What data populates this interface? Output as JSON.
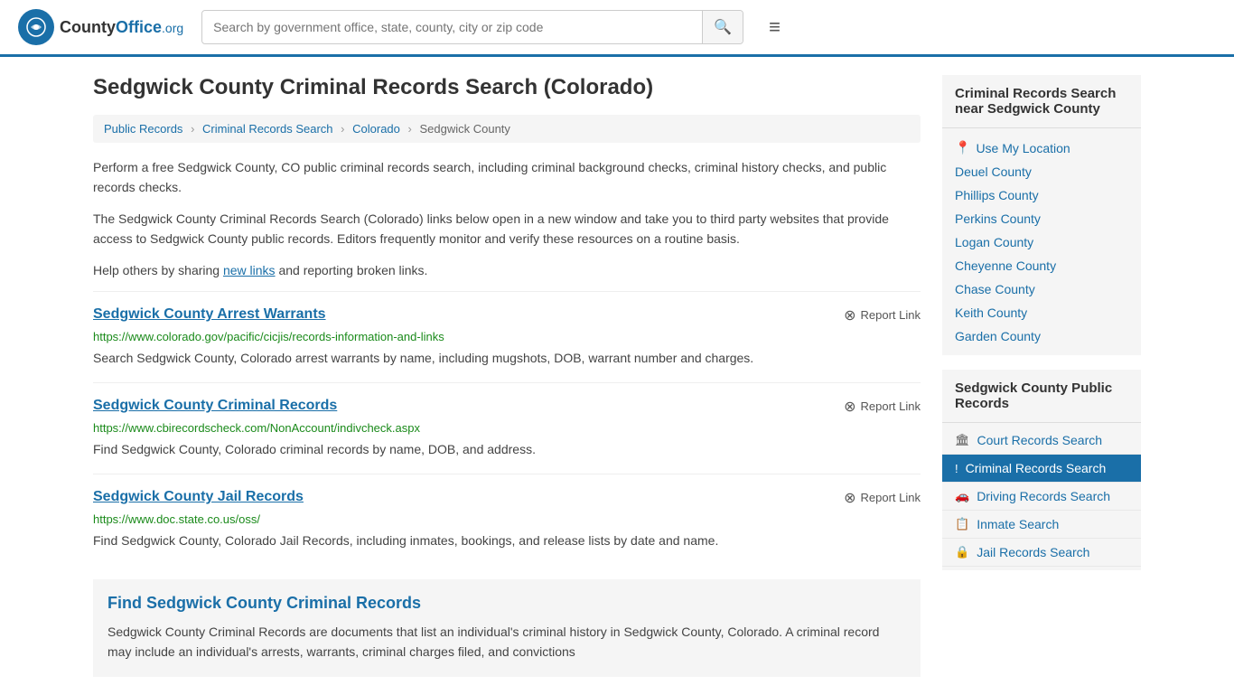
{
  "header": {
    "logo_text": "CountyOffice",
    "logo_suffix": ".org",
    "search_placeholder": "Search by government office, state, county, city or zip code",
    "search_icon": "🔍",
    "menu_icon": "≡"
  },
  "page": {
    "title": "Sedgwick County Criminal Records Search (Colorado)",
    "breadcrumb": [
      {
        "label": "Public Records",
        "href": "#"
      },
      {
        "label": "Criminal Records Search",
        "href": "#"
      },
      {
        "label": "Colorado",
        "href": "#"
      },
      {
        "label": "Sedgwick County",
        "href": "#"
      }
    ],
    "desc1": "Perform a free Sedgwick County, CO public criminal records search, including criminal background checks, criminal history checks, and public records checks.",
    "desc2": "The Sedgwick County Criminal Records Search (Colorado) links below open in a new window and take you to third party websites that provide access to Sedgwick County public records. Editors frequently monitor and verify these resources on a routine basis.",
    "desc3_prefix": "Help others by sharing ",
    "desc3_link": "new links",
    "desc3_suffix": " and reporting broken links.",
    "records": [
      {
        "title": "Sedgwick County Arrest Warrants",
        "url": "https://www.colorado.gov/pacific/cicjis/records-information-and-links",
        "desc": "Search Sedgwick County, Colorado arrest warrants by name, including mugshots, DOB, warrant number and charges.",
        "report_label": "Report Link"
      },
      {
        "title": "Sedgwick County Criminal Records",
        "url": "https://www.cbirecordscheck.com/NonAccount/indivcheck.aspx",
        "desc": "Find Sedgwick County, Colorado criminal records by name, DOB, and address.",
        "report_label": "Report Link"
      },
      {
        "title": "Sedgwick County Jail Records",
        "url": "https://www.doc.state.co.us/oss/",
        "desc": "Find Sedgwick County, Colorado Jail Records, including inmates, bookings, and release lists by date and name.",
        "report_label": "Report Link"
      }
    ],
    "find_section": {
      "title": "Find Sedgwick County Criminal Records",
      "desc": "Sedgwick County Criminal Records are documents that list an individual's criminal history in Sedgwick County, Colorado. A criminal record may include an individual's arrests, warrants, criminal charges filed, and convictions"
    }
  },
  "sidebar": {
    "nearby_title": "Criminal Records Search near Sedgwick County",
    "use_my_location": "Use My Location",
    "nearby_counties": [
      {
        "label": "Deuel County",
        "href": "#"
      },
      {
        "label": "Phillips County",
        "href": "#"
      },
      {
        "label": "Perkins County",
        "href": "#"
      },
      {
        "label": "Logan County",
        "href": "#"
      },
      {
        "label": "Cheyenne County",
        "href": "#"
      },
      {
        "label": "Chase County",
        "href": "#"
      },
      {
        "label": "Keith County",
        "href": "#"
      },
      {
        "label": "Garden County",
        "href": "#"
      }
    ],
    "public_title": "Sedgwick County Public Records",
    "public_links": [
      {
        "label": "Court Records Search",
        "icon": "🏛",
        "active": false
      },
      {
        "label": "Criminal Records Search",
        "icon": "!",
        "active": true
      },
      {
        "label": "Driving Records Search",
        "icon": "🚗",
        "active": false
      },
      {
        "label": "Inmate Search",
        "icon": "📋",
        "active": false
      },
      {
        "label": "Jail Records Search",
        "icon": "🔒",
        "active": false
      }
    ]
  }
}
